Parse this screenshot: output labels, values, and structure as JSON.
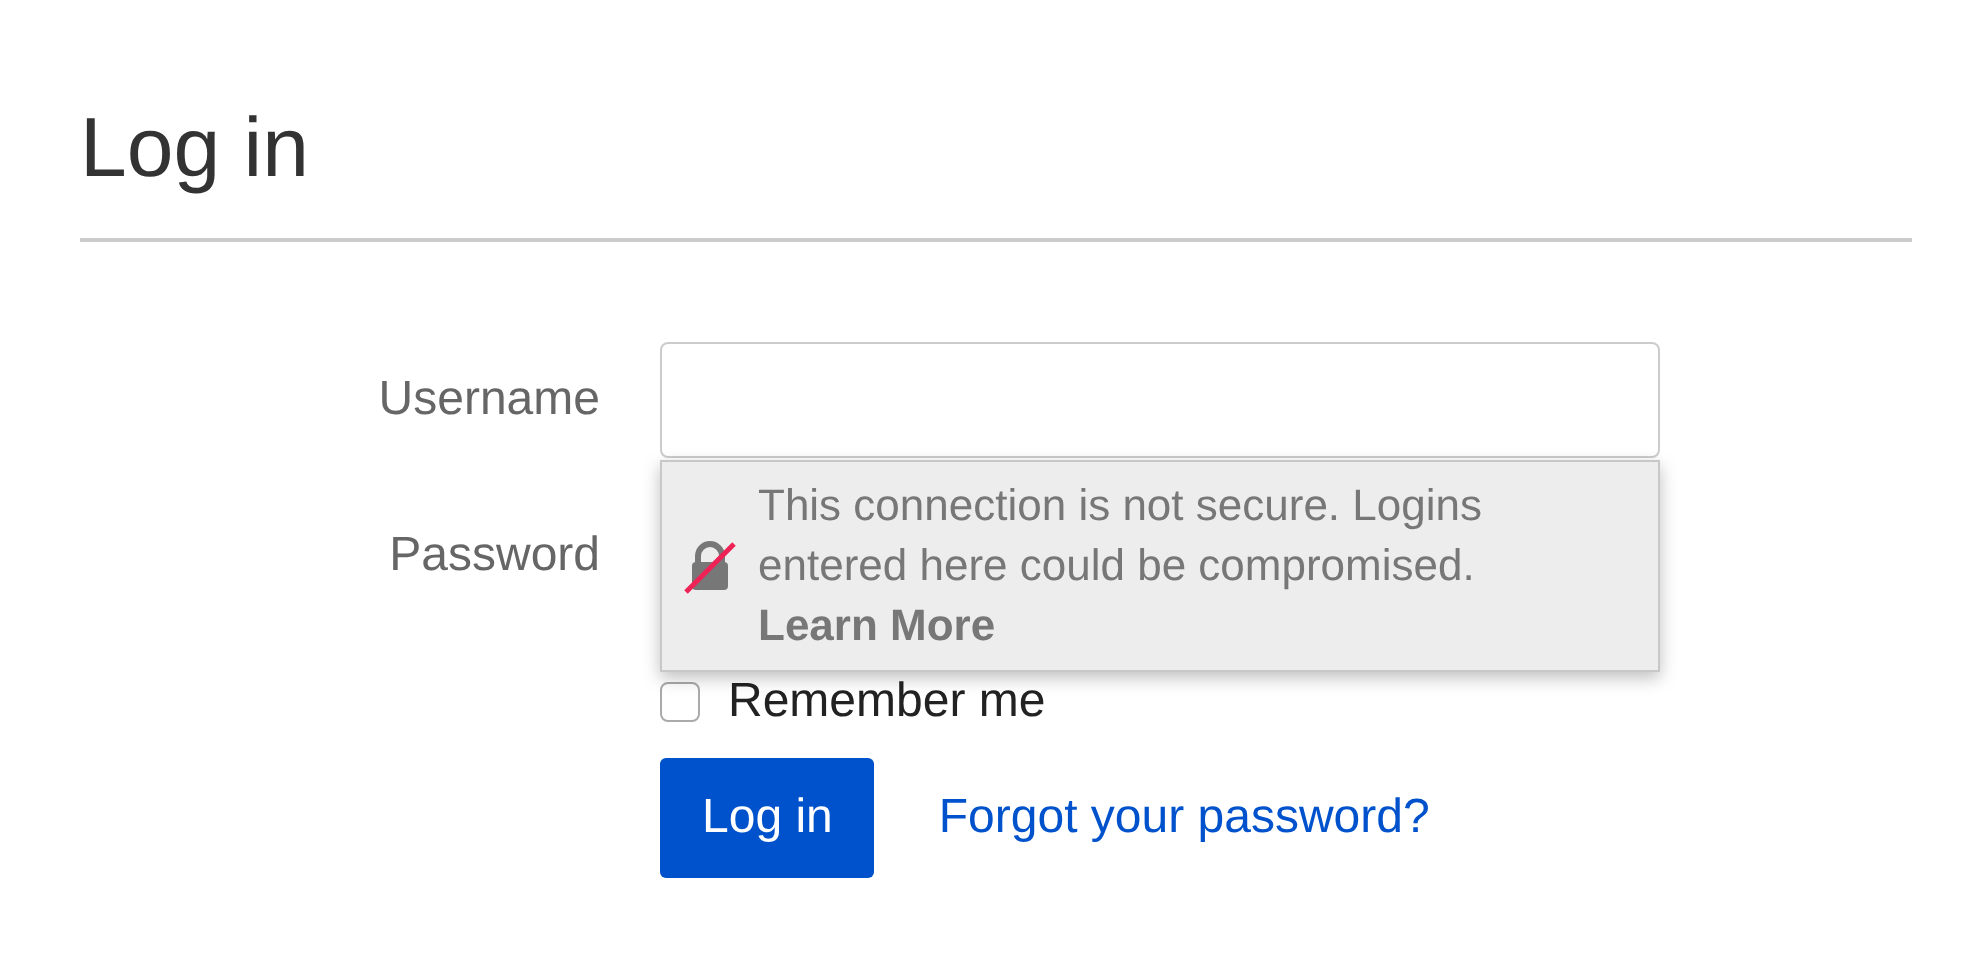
{
  "heading": "Log in",
  "fields": [
    {
      "label": "Username"
    },
    {
      "label": "Password"
    }
  ],
  "remember": {
    "label": "Remember me",
    "checked": false
  },
  "submit": "Log in",
  "forgot_link": "Forgot your password?",
  "warning_popup": {
    "message": "This connection is not secure. Logins entered here could be compromised.",
    "link": "Learn More"
  }
}
